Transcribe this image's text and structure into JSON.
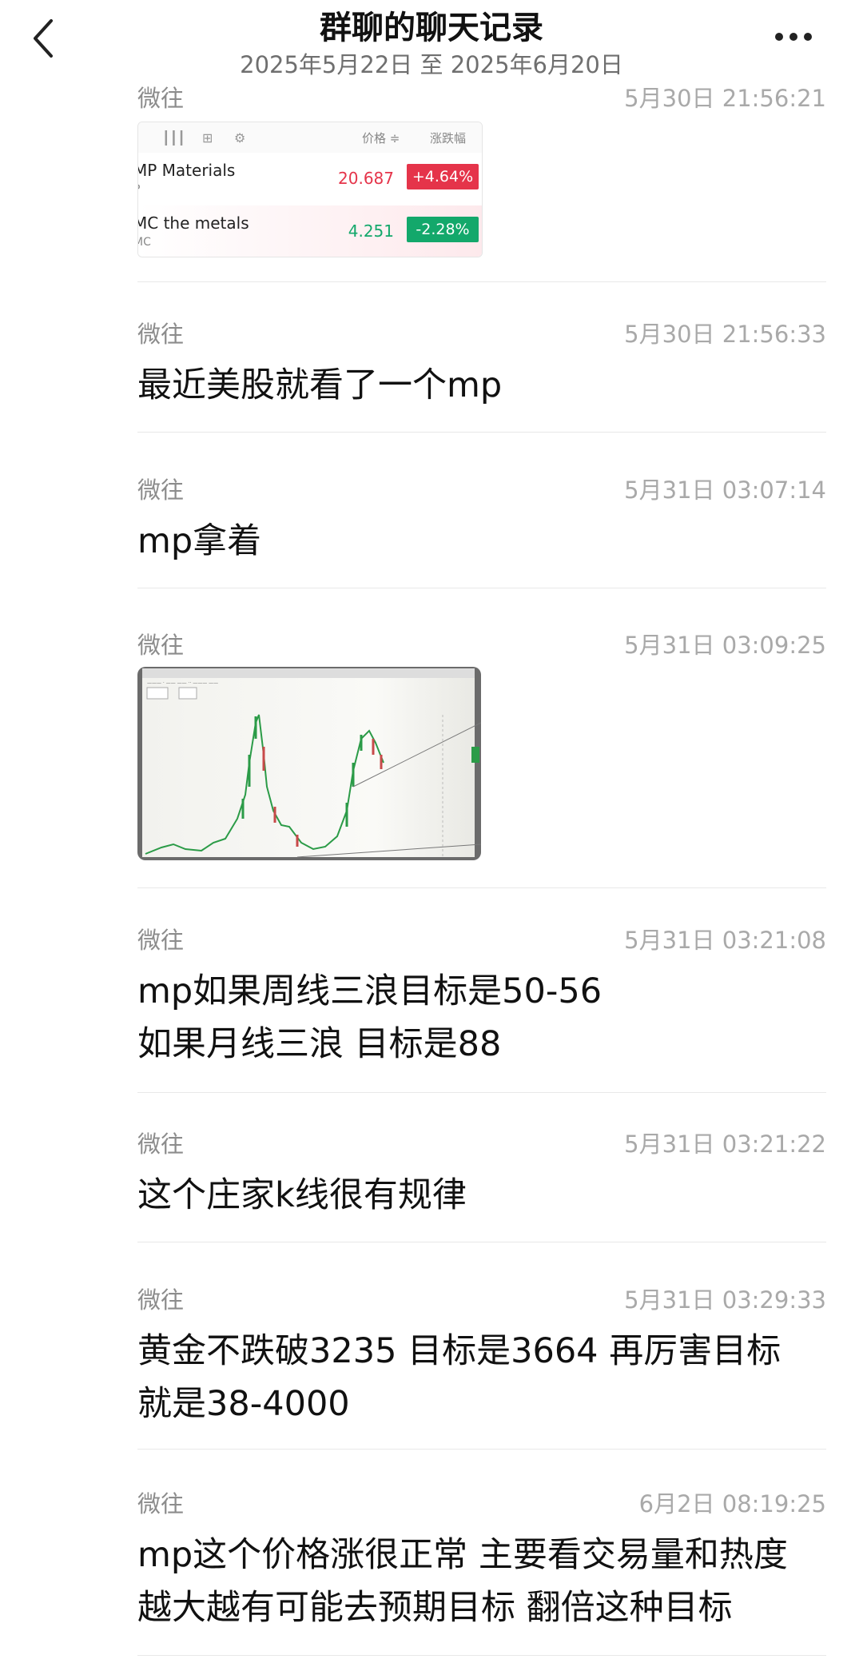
{
  "header": {
    "title": "群聊的聊天记录",
    "subtitle": "2025年5月22日 至 2025年6月20日"
  },
  "stock_card": {
    "columns": {
      "price": "价格 ≑",
      "change": "涨跌幅"
    },
    "rows": [
      {
        "name": "MP Materials",
        "code": "P",
        "price": "20.687",
        "change": "+4.64%",
        "color": "#e5344a"
      },
      {
        "name": "MC the metals",
        "code": "MC",
        "price": "4.251",
        "change": "-2.28%",
        "color": "#13a86b"
      }
    ]
  },
  "messages": [
    {
      "sender": "微往",
      "time": "5月30日 21:56:21",
      "text": ""
    },
    {
      "sender": "微往",
      "time": "5月30日 21:56:33",
      "text": "最近美股就看了一个mp"
    },
    {
      "sender": "微往",
      "time": "5月31日 03:07:14",
      "text": "mp拿着"
    },
    {
      "sender": "微往",
      "time": "5月31日 03:09:25",
      "text": ""
    },
    {
      "sender": "微往",
      "time": "5月31日 03:21:08",
      "text": "mp如果周线三浪目标是50-56\n如果月线三浪 目标是88"
    },
    {
      "sender": "微往",
      "time": "5月31日 03:21:22",
      "text": "这个庄家k线很有规律"
    },
    {
      "sender": "微往",
      "time": "5月31日 03:29:33",
      "text": "黄金不跌破3235 目标是3664 再厉害目标\n就是38-4000"
    },
    {
      "sender": "微往",
      "time": "6月2日 08:19:25",
      "text": "mp这个价格涨很正常 主要看交易量和热度\n越大越有可能去预期目标 翻倍这种目标"
    }
  ]
}
